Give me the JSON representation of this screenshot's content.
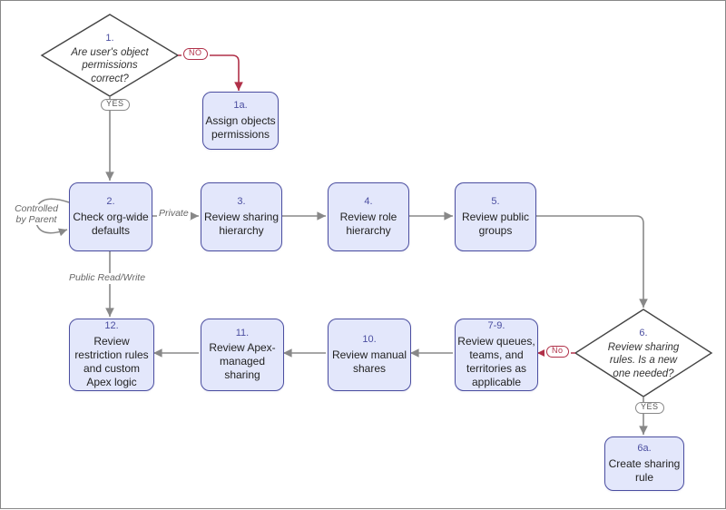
{
  "chart_data": {
    "type": "flowchart",
    "nodes": [
      {
        "id": "d1",
        "kind": "decision",
        "num": "1.",
        "text": "Are user's object permissions correct?"
      },
      {
        "id": "p1a",
        "kind": "process",
        "num": "1a.",
        "text": "Assign objects permissions"
      },
      {
        "id": "p2",
        "kind": "process",
        "num": "2.",
        "text": "Check org-wide defaults"
      },
      {
        "id": "p3",
        "kind": "process",
        "num": "3.",
        "text": "Review sharing hierarchy"
      },
      {
        "id": "p4",
        "kind": "process",
        "num": "4.",
        "text": "Review role hierarchy"
      },
      {
        "id": "p5",
        "kind": "process",
        "num": "5.",
        "text": "Review public groups"
      },
      {
        "id": "d6",
        "kind": "decision",
        "num": "6.",
        "text": "Review sharing rules. Is a new one needed?"
      },
      {
        "id": "p6a",
        "kind": "process",
        "num": "6a.",
        "text": "Create sharing rule"
      },
      {
        "id": "p79",
        "kind": "process",
        "num": "7-9.",
        "text": "Review queues, teams, and territories as applicable"
      },
      {
        "id": "p10",
        "kind": "process",
        "num": "10.",
        "text": "Review manual shares"
      },
      {
        "id": "p11",
        "kind": "process",
        "num": "11.",
        "text": "Review Apex-managed sharing"
      },
      {
        "id": "p12",
        "kind": "process",
        "num": "12.",
        "text": "Review restriction rules and custom Apex logic"
      }
    ],
    "edges": [
      {
        "from": "d1",
        "to": "p1a",
        "label": "NO"
      },
      {
        "from": "d1",
        "to": "p2",
        "label": "YES"
      },
      {
        "from": "p2",
        "to": "p2",
        "label": "Controlled by Parent"
      },
      {
        "from": "p2",
        "to": "p3",
        "label": "Private"
      },
      {
        "from": "p2",
        "to": "p12",
        "label": "Public Read/Write"
      },
      {
        "from": "p3",
        "to": "p4",
        "label": ""
      },
      {
        "from": "p4",
        "to": "p5",
        "label": ""
      },
      {
        "from": "p5",
        "to": "d6",
        "label": ""
      },
      {
        "from": "d6",
        "to": "p6a",
        "label": "YES"
      },
      {
        "from": "d6",
        "to": "p79",
        "label": "No"
      },
      {
        "from": "p79",
        "to": "p10",
        "label": ""
      },
      {
        "from": "p10",
        "to": "p11",
        "label": ""
      },
      {
        "from": "p11",
        "to": "p12",
        "label": ""
      }
    ]
  },
  "labels": {
    "yes": "YES",
    "no_upper": "NO",
    "no": "No",
    "private": "Private",
    "publicrw": "Public Read/Write",
    "controlled": "Controlled by Parent"
  }
}
